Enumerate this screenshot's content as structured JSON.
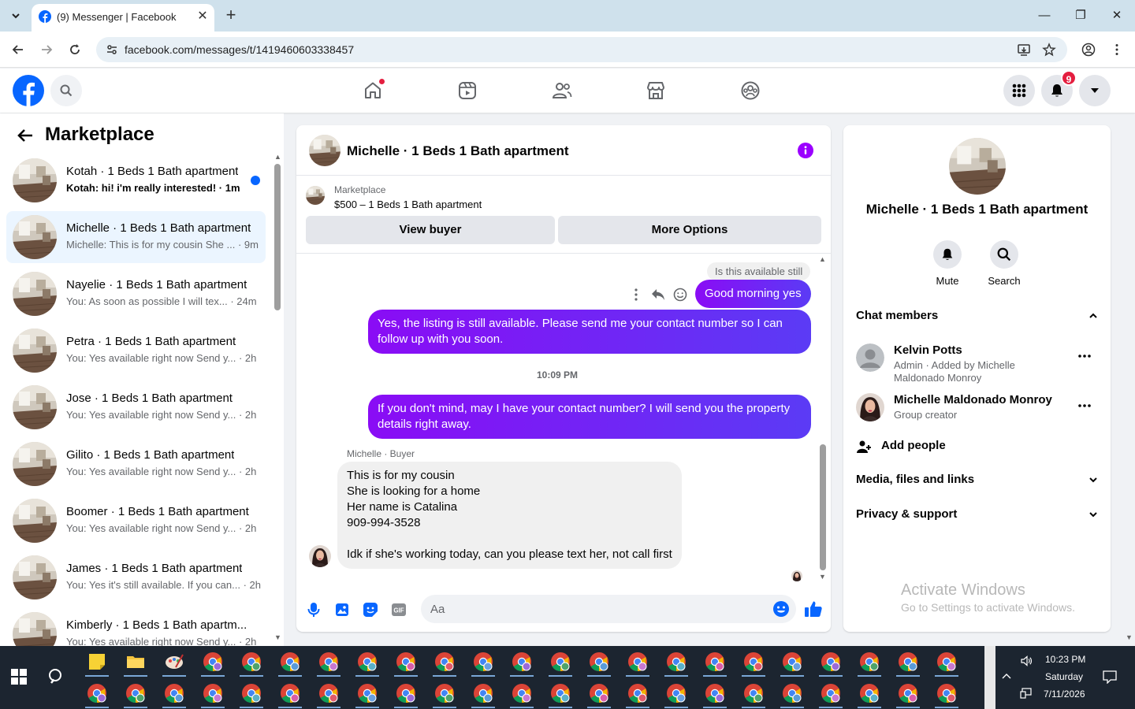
{
  "browser": {
    "tab_title": "(9) Messenger | Facebook",
    "url": "facebook.com/messages/t/1419460603338457"
  },
  "header": {
    "notif_count": "9"
  },
  "left": {
    "title": "Marketplace",
    "conversations": [
      {
        "name": "Kotah · 1 Beds 1 Bath apartment",
        "preview": "Kotah: hi! i'm really interested! · 1m",
        "unread": true
      },
      {
        "name": "Michelle · 1 Beds 1 Bath apartment",
        "preview": "Michelle: This is for my cousin She ... · 9m",
        "active": true
      },
      {
        "name": "Nayelie · 1 Beds 1 Bath apartment",
        "preview": "You: As soon as possible I will tex... · 24m"
      },
      {
        "name": "Petra · 1 Beds 1 Bath apartment",
        "preview": "You: Yes available right now Send y... · 2h"
      },
      {
        "name": "Jose · 1 Beds 1 Bath apartment",
        "preview": "You: Yes available right now Send y... · 2h"
      },
      {
        "name": "Gilito · 1 Beds 1 Bath apartment",
        "preview": "You: Yes available right now Send y... · 2h"
      },
      {
        "name": "Boomer · 1 Beds 1 Bath apartment",
        "preview": "You: Yes available right now Send y... · 2h"
      },
      {
        "name": "James · 1 Beds 1 Bath apartment",
        "preview": "You: Yes it's still available. If you can... · 2h"
      },
      {
        "name": "Kimberly · 1 Beds 1 Bath apartm...",
        "preview": "You: Yes available right now Send y... · 2h"
      }
    ]
  },
  "chat": {
    "title": "Michelle · 1 Beds 1 Bath apartment",
    "listing_source": "Marketplace",
    "listing_desc": "$500 – 1 Beds 1 Bath apartment",
    "view_buyer": "View buyer",
    "more_options": "More Options",
    "reply_quote": "Is this available still",
    "msg1": "Good morning yes",
    "msg2": "Yes, the listing is still available. Please send me your contact number so I can follow up with you soon.",
    "time_sep": "10:09 PM",
    "msg3": "If you don't mind, may I have your contact number? I will send you the property details right away.",
    "sender_label": "Michelle · Buyer",
    "msg4": "This is for my cousin\nShe is looking for a home\nHer name is Catalina\n909-994-3528\n\nIdk if she's working today, can you please text her, not call first",
    "input_placeholder": "Aa"
  },
  "right": {
    "name": "Michelle · 1 Beds 1 Bath apartment",
    "mute": "Mute",
    "search": "Search",
    "chat_members": "Chat members",
    "members": [
      {
        "name": "Kelvin Potts",
        "role": "Admin · Added by Michelle Maldonado Monroy"
      },
      {
        "name": "Michelle Maldonado Monroy",
        "role": "Group creator"
      }
    ],
    "add_people": "Add people",
    "media": "Media, files and links",
    "privacy": "Privacy & support"
  },
  "watermark": {
    "line1": "Activate Windows",
    "line2": "Go to Settings to activate Windows."
  },
  "taskbar": {
    "time": "10:23 PM",
    "day": "Saturday",
    "date": "7/11/2026"
  },
  "colors": {
    "fb_blue": "#0866ff",
    "bubble_purple": "#7a1bf5",
    "badge_red": "#e41e3f"
  }
}
